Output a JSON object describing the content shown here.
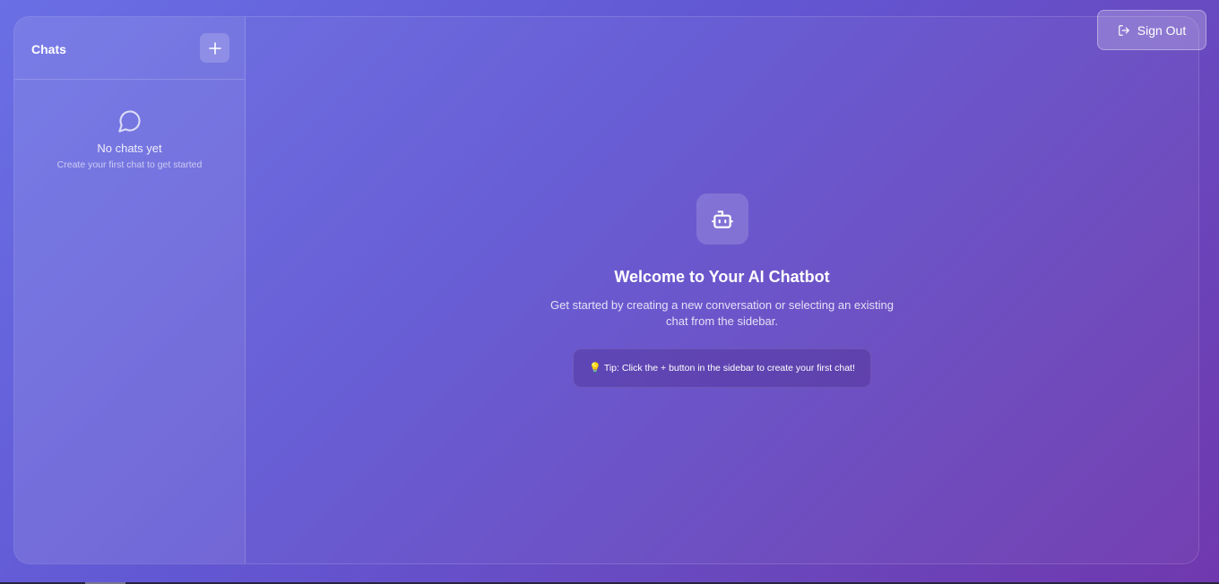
{
  "sidebar": {
    "title": "Chats",
    "new_chat_icon": "plus-icon",
    "empty_state": {
      "icon": "message-circle-icon",
      "title": "No chats yet",
      "subtitle": "Create your first chat to get started"
    }
  },
  "main": {
    "icon": "bot-icon",
    "title": "Welcome to Your AI Chatbot",
    "description": "Get started by creating a new conversation or selecting an existing chat from the sidebar.",
    "tip": {
      "icon": "💡",
      "text": "Tip: Click the + button in the sidebar to create your first chat!"
    }
  },
  "header": {
    "sign_out_label": "Sign Out",
    "sign_out_icon": "log-out-icon"
  },
  "colors": {
    "background_start": "#6a6fe4",
    "background_end": "#7038ae",
    "text": "#ffffff"
  }
}
